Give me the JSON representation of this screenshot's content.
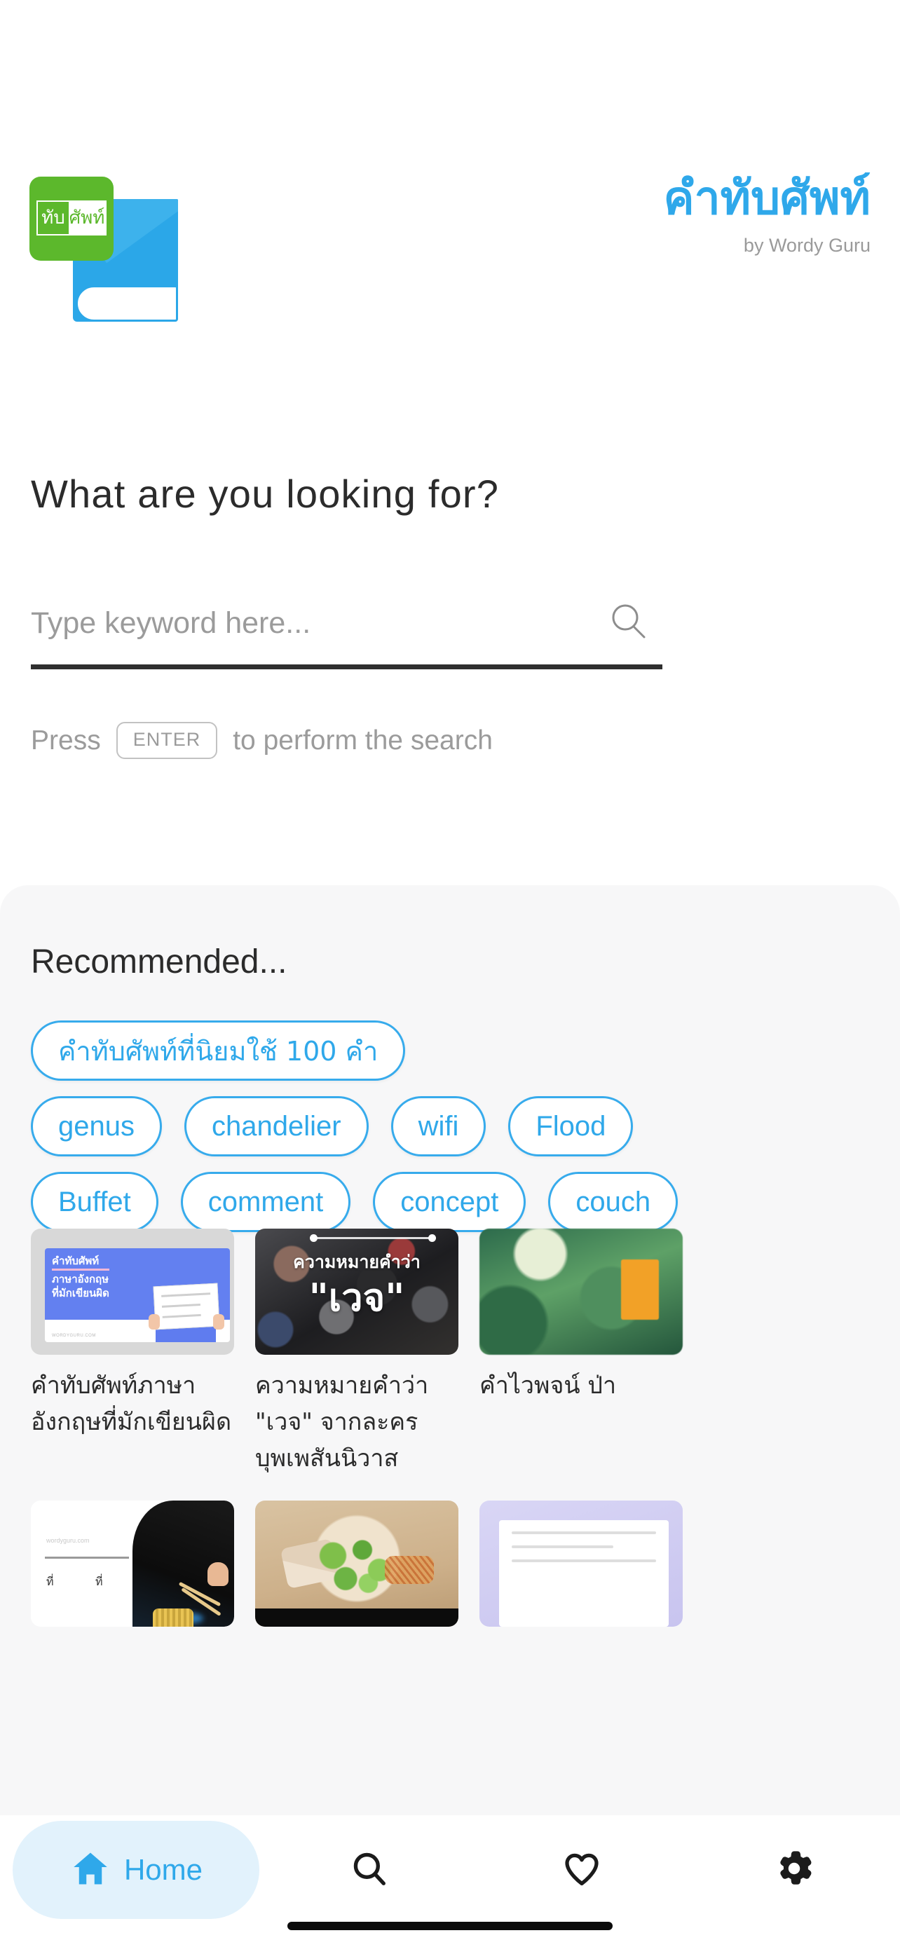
{
  "brand": {
    "title": "คำทับศัพท์",
    "subtitle": "by Wordy Guru",
    "logo_text_left": "ทับ",
    "logo_text_right": "ศัพท์",
    "accent_color": "#2FA8EA",
    "logo_green": "#5CB82C",
    "logo_blue": "#2BA7E8"
  },
  "search": {
    "heading": "What are you looking for?",
    "placeholder": "Type keyword here...",
    "value": "",
    "hint_before": "Press",
    "hint_key": "ENTER",
    "hint_after": "to perform the search"
  },
  "recommended": {
    "title": "Recommended...",
    "rows": [
      [
        {
          "label": "คำทับศัพท์ที่นิยมใช้ 100 คำ",
          "thai": true
        }
      ],
      [
        {
          "label": "genus",
          "thai": false
        },
        {
          "label": "chandelier",
          "thai": false
        },
        {
          "label": "wifi",
          "thai": false
        },
        {
          "label": "Flood",
          "thai": false
        }
      ],
      [
        {
          "label": "Buffet",
          "thai": false
        },
        {
          "label": "comment",
          "thai": false
        },
        {
          "label": "concept",
          "thai": false
        },
        {
          "label": "couch",
          "thai": false
        }
      ]
    ]
  },
  "cards": {
    "row1": [
      {
        "title": "คำทับศัพท์ภาษาอังกฤษที่มักเขียนผิด",
        "thumb_line1": "คำทับศัพท์",
        "thumb_line2": "ภาษาอังกฤษ",
        "thumb_line3": "ที่มักเขียนผิด",
        "thumb_watermark": "WORDYGURU.COM"
      },
      {
        "title": "ความหมายคำว่า \"เวจ\" จากละครบุพเพสันนิวาส",
        "overlay_line1": "ความหมายคำว่า",
        "overlay_line2": "\"เวจ\""
      },
      {
        "title": "คำไวพจน์ ป่า"
      }
    ],
    "row2": [
      {
        "thumb_watermark": "wordyguru.com",
        "thumb_tl1": "ที่",
        "thumb_tl2": "ที่"
      },
      {
        "title": ""
      },
      {
        "title": ""
      }
    ]
  },
  "nav": {
    "items": [
      {
        "label": "Home",
        "icon": "home-icon",
        "active": true
      },
      {
        "label": "",
        "icon": "search-icon",
        "active": false
      },
      {
        "label": "",
        "icon": "heart-icon",
        "active": false
      },
      {
        "label": "",
        "icon": "gear-icon",
        "active": false
      }
    ]
  }
}
